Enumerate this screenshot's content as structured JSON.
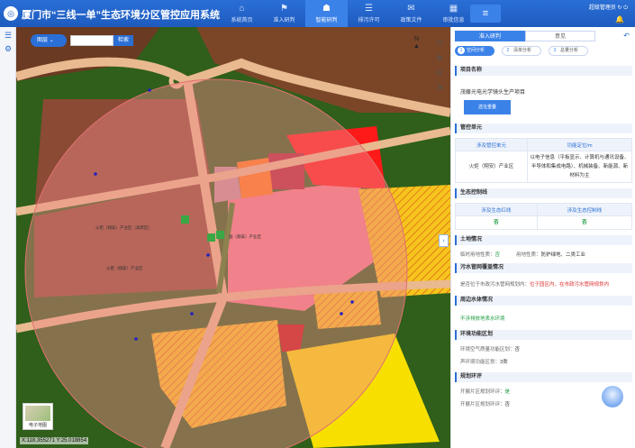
{
  "header": {
    "app_title": "厦门市“三线一单”生态环境分区管控应用系统",
    "nav": [
      {
        "label": "系统首页",
        "icon": "⌂"
      },
      {
        "label": "准入研判",
        "icon": "⚑"
      },
      {
        "label": "智能研判",
        "icon": "☗",
        "active": true
      },
      {
        "label": "排污许可",
        "icon": "☰"
      },
      {
        "label": "政策文件",
        "icon": "✉"
      },
      {
        "label": "审批信息",
        "icon": "▦"
      }
    ],
    "menu_icon": "≡",
    "user_label": "超级管理员",
    "accent_color": "#1e5bbf"
  },
  "map": {
    "layer_button": "图层",
    "search_placeholder": "",
    "search_button": "检索",
    "north_label": "N",
    "tools": [
      "⏻",
      "⊕",
      "⊖",
      "⇲"
    ],
    "basemap_label": "电子地图",
    "coords": "X:118.355271 Y:25.018854",
    "parcel_labels": [
      "火炬（翔安）产业区（高新区）",
      "国（翔安）产业区",
      "火炬（翔安）产业区"
    ],
    "colors": {
      "circle": "#f08a8a",
      "road": "#e9b98f",
      "green_belt": "#3f7a22",
      "industrial": "#8a4a34",
      "red_zone": "#ff1a1a",
      "yellow_hatch": "#f5c518",
      "pink": "#f47c8c"
    }
  },
  "panel": {
    "tabs": [
      {
        "label": "准入研判",
        "active": true
      },
      {
        "label": "意见"
      }
    ],
    "steps": [
      {
        "num": "1",
        "label": "空间分析",
        "active": true
      },
      {
        "num": "2",
        "label": "清单分析"
      },
      {
        "num": "3",
        "label": "总量分析"
      }
    ],
    "project_section": "项目名称",
    "project_name": "茂藤光电光学镜头生产项目",
    "project_button": "选址重叠",
    "control_section": "管控单元",
    "control_headers": [
      "涉及管控单元",
      "功能定位/m"
    ],
    "control_row": {
      "unit": "火炬（翔安）产业区",
      "function": "以电子信息（平板显示、计算机与通讯设备、半导体和集成电路）、机械装备、新能源、新材料为主"
    },
    "eco_section": "生态控制线",
    "eco_headers": [
      "涉及生态红线",
      "涉及生态控制线"
    ],
    "eco_values": [
      "否",
      "否"
    ],
    "land_section": "土地情况",
    "land_items": [
      {
        "label": "临时用地性质：",
        "value": "否",
        "style": "green"
      },
      {
        "label": "用地性质：",
        "value": "防护绿地、二类工业",
        "style": "plain"
      }
    ],
    "sewage_section": "污水管网覆盖情况",
    "sewage_question": "是否位于市政污水管网规划内：",
    "sewage_answer": "位于园区内，在市政污水管网规划内",
    "water_section": "周边水体情况",
    "water_text": "不涉排放地表水环境",
    "env_section": "环境功能区划",
    "env_items": [
      {
        "label": "环境空气质量功能区划：",
        "value": "否"
      },
      {
        "label": "声环境功能区划：",
        "value": "3类"
      }
    ],
    "plan_section": "规划环评",
    "plan_items": [
      {
        "label": "开展片区规划环评：",
        "value": "是"
      },
      {
        "label": "开展片区规划环评：",
        "value": "否"
      }
    ]
  }
}
